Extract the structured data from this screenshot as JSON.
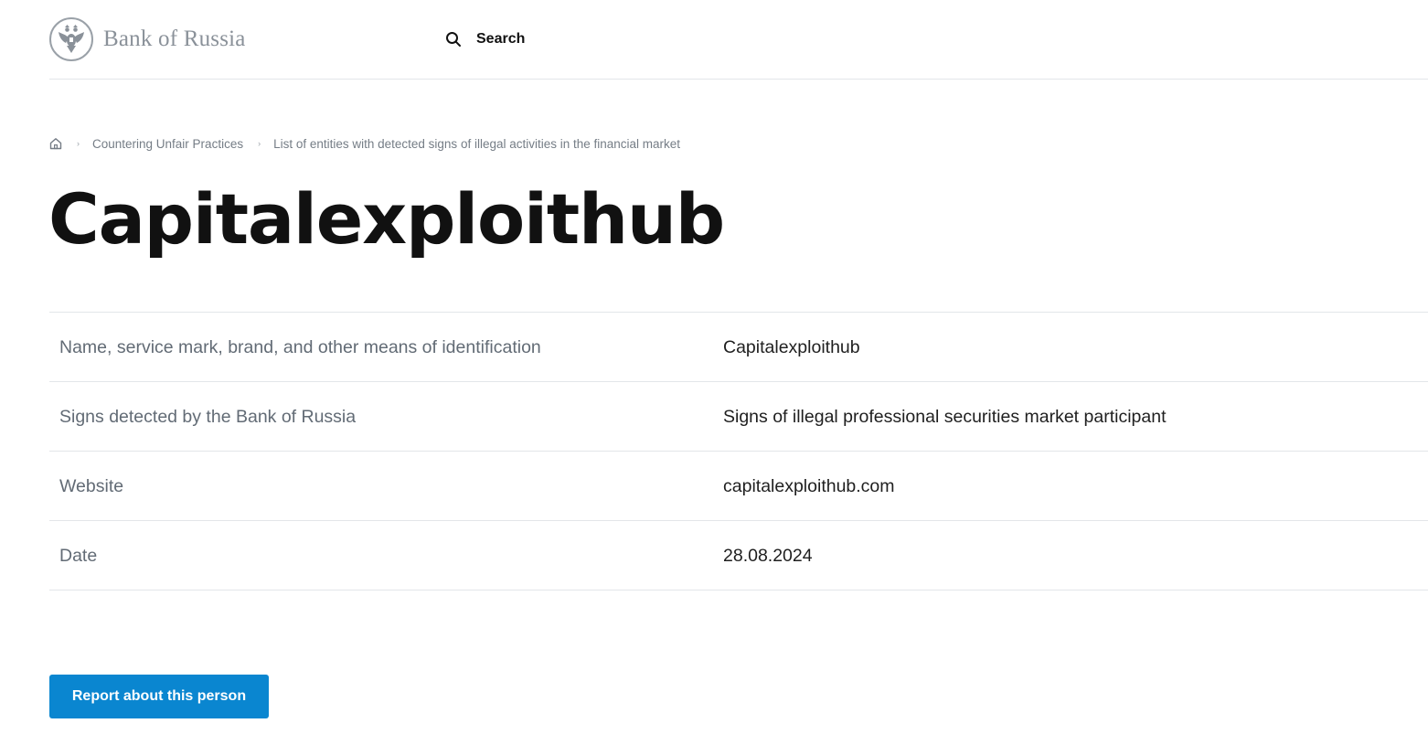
{
  "header": {
    "logo_text": "Bank of Russia",
    "search_label": "Search"
  },
  "breadcrumb": {
    "home_icon": "home-icon",
    "items": [
      "Countering Unfair Practices",
      "List of entities with detected signs of illegal activities in the financial market"
    ]
  },
  "page": {
    "title": "Capitalexploithub"
  },
  "details": {
    "rows": [
      {
        "label": "Name, service mark, brand, and other means of identification",
        "value": "Capitalexploithub"
      },
      {
        "label": "Signs detected by the Bank of Russia",
        "value": "Signs of illegal professional securities market participant"
      },
      {
        "label": "Website",
        "value": "capitalexploithub.com"
      },
      {
        "label": "Date",
        "value": "28.08.2024"
      }
    ]
  },
  "actions": {
    "report_label": "Report about this person"
  },
  "colors": {
    "accent": "#0a86d0",
    "title": "#111111",
    "muted": "#757d86",
    "divider": "#e3e6e9"
  }
}
